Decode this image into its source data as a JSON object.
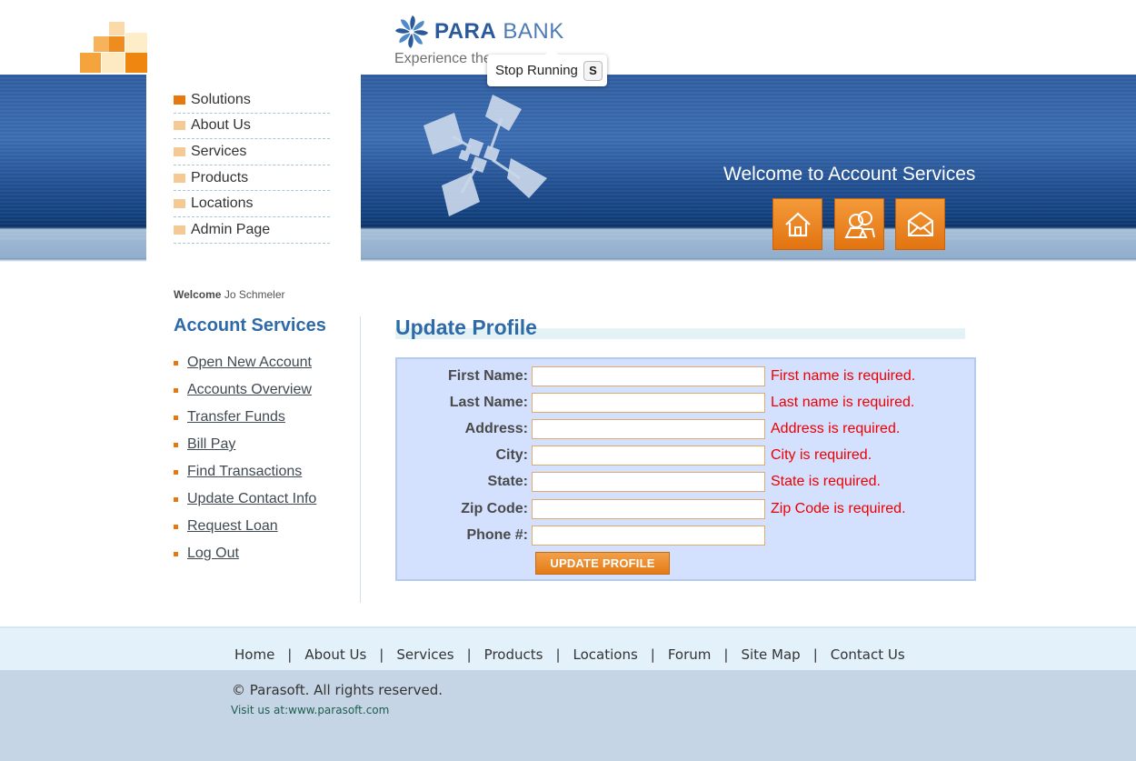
{
  "header": {
    "logo_para": "PARA",
    "logo_bank": "BANK",
    "tagline": "Experience the",
    "tooltip_label": "Stop Running",
    "tooltip_key": "S",
    "banner_title": "Welcome to Account Services"
  },
  "top_nav": [
    {
      "label": "Solutions",
      "active": true
    },
    {
      "label": "About Us",
      "active": false
    },
    {
      "label": "Services",
      "active": false
    },
    {
      "label": "Products",
      "active": false
    },
    {
      "label": "Locations",
      "active": false
    },
    {
      "label": "Admin Page",
      "active": false
    }
  ],
  "user": {
    "welcome_label": "Welcome",
    "name": "Jo Schmeler"
  },
  "account_services": {
    "title": "Account Services",
    "items": [
      "Open New Account",
      "Accounts Overview",
      "Transfer Funds",
      "Bill Pay",
      "Find Transactions",
      "Update Contact Info",
      "Request Loan",
      "Log Out"
    ]
  },
  "main": {
    "title": "Update Profile",
    "fields": [
      {
        "label": "First Name:",
        "value": "",
        "error": "First name is required."
      },
      {
        "label": "Last Name:",
        "value": "",
        "error": "Last name is required."
      },
      {
        "label": "Address:",
        "value": "",
        "error": "Address is required."
      },
      {
        "label": "City:",
        "value": "",
        "error": "City is required."
      },
      {
        "label": "State:",
        "value": "",
        "error": "State is required."
      },
      {
        "label": "Zip Code:",
        "value": "",
        "error": "Zip Code is required."
      },
      {
        "label": "Phone #:",
        "value": "",
        "error": ""
      }
    ],
    "submit_label": "UPDATE PROFILE"
  },
  "footer": {
    "links": [
      "Home",
      "About Us",
      "Services",
      "Products",
      "Locations",
      "Forum",
      "Site Map",
      "Contact Us"
    ],
    "separator": "|",
    "copyright": "© Parasoft. All rights reserved.",
    "visit": "Visit us at:www.parasoft.com"
  },
  "colors": {
    "accent_orange": "#e5780f",
    "brand_blue": "#2f6aa8",
    "error_red": "#ee0000",
    "form_bg": "#d3e0fe"
  },
  "icons": {
    "banner_buttons": [
      "home-icon",
      "people-icon",
      "envelope-icon"
    ]
  }
}
